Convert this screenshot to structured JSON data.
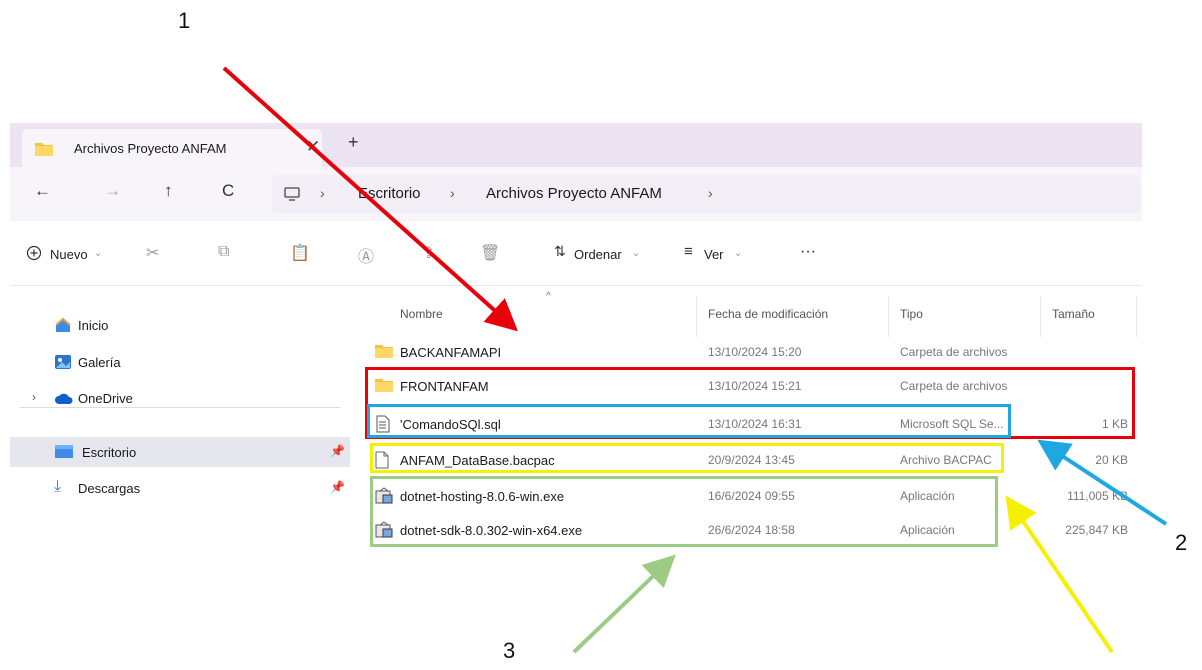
{
  "annotations": {
    "label_1": "1",
    "label_2": "2",
    "label_3": "3",
    "colors": {
      "red": "#e8000b",
      "blue": "#1ea7e1",
      "yellow": "#f5f000",
      "green": "#9ccc84"
    }
  },
  "window": {
    "tab_title": "Archivos Proyecto ANFAM",
    "tab_close": "✕",
    "tab_add": "+"
  },
  "nav": {
    "back": "←",
    "forward": "→",
    "up": "↑",
    "refresh": "C",
    "sep": "›",
    "breadcrumb": [
      "Escritorio",
      "Archivos Proyecto ANFAM"
    ]
  },
  "toolbar": {
    "new_label": "Nuevo",
    "sort_label": "Ordenar",
    "view_label": "Ver",
    "more_label": "···"
  },
  "sidebar": {
    "items": [
      {
        "label": "Inicio",
        "icon": "home-icon"
      },
      {
        "label": "Galería",
        "icon": "gallery-icon"
      },
      {
        "label": "OneDrive",
        "icon": "cloud-icon"
      },
      {
        "label": "Escritorio",
        "icon": "desktop-icon",
        "selected": true
      },
      {
        "label": "Descargas",
        "icon": "download-icon"
      }
    ]
  },
  "columns": {
    "name": "Nombre",
    "date": "Fecha de modificación",
    "type": "Tipo",
    "size": "Tamaño"
  },
  "files": [
    {
      "name": "BACKANFAMAPI",
      "date": "13/10/2024 15:20",
      "type": "Carpeta de archivos",
      "size": "",
      "icon": "folder-icon"
    },
    {
      "name": "FRONTANFAM",
      "date": "13/10/2024 15:21",
      "type": "Carpeta de archivos",
      "size": "",
      "icon": "folder-icon"
    },
    {
      "name": "'ComandoSQl.sql",
      "date": "13/10/2024 16:31",
      "type": "Microsoft SQL Se...",
      "size": "1 KB",
      "icon": "sql-file-icon"
    },
    {
      "name": "ANFAM_DataBase.bacpac",
      "date": "20/9/2024 13:45",
      "type": "Archivo BACPAC",
      "size": "20 KB",
      "icon": "file-icon"
    },
    {
      "name": "dotnet-hosting-8.0.6-win.exe",
      "date": "16/6/2024 09:55",
      "type": "Aplicación",
      "size": "111,005 KB",
      "icon": "installer-icon"
    },
    {
      "name": "dotnet-sdk-8.0.302-win-x64.exe",
      "date": "26/6/2024 18:58",
      "type": "Aplicación",
      "size": "225,847 KB",
      "icon": "installer-icon"
    }
  ]
}
